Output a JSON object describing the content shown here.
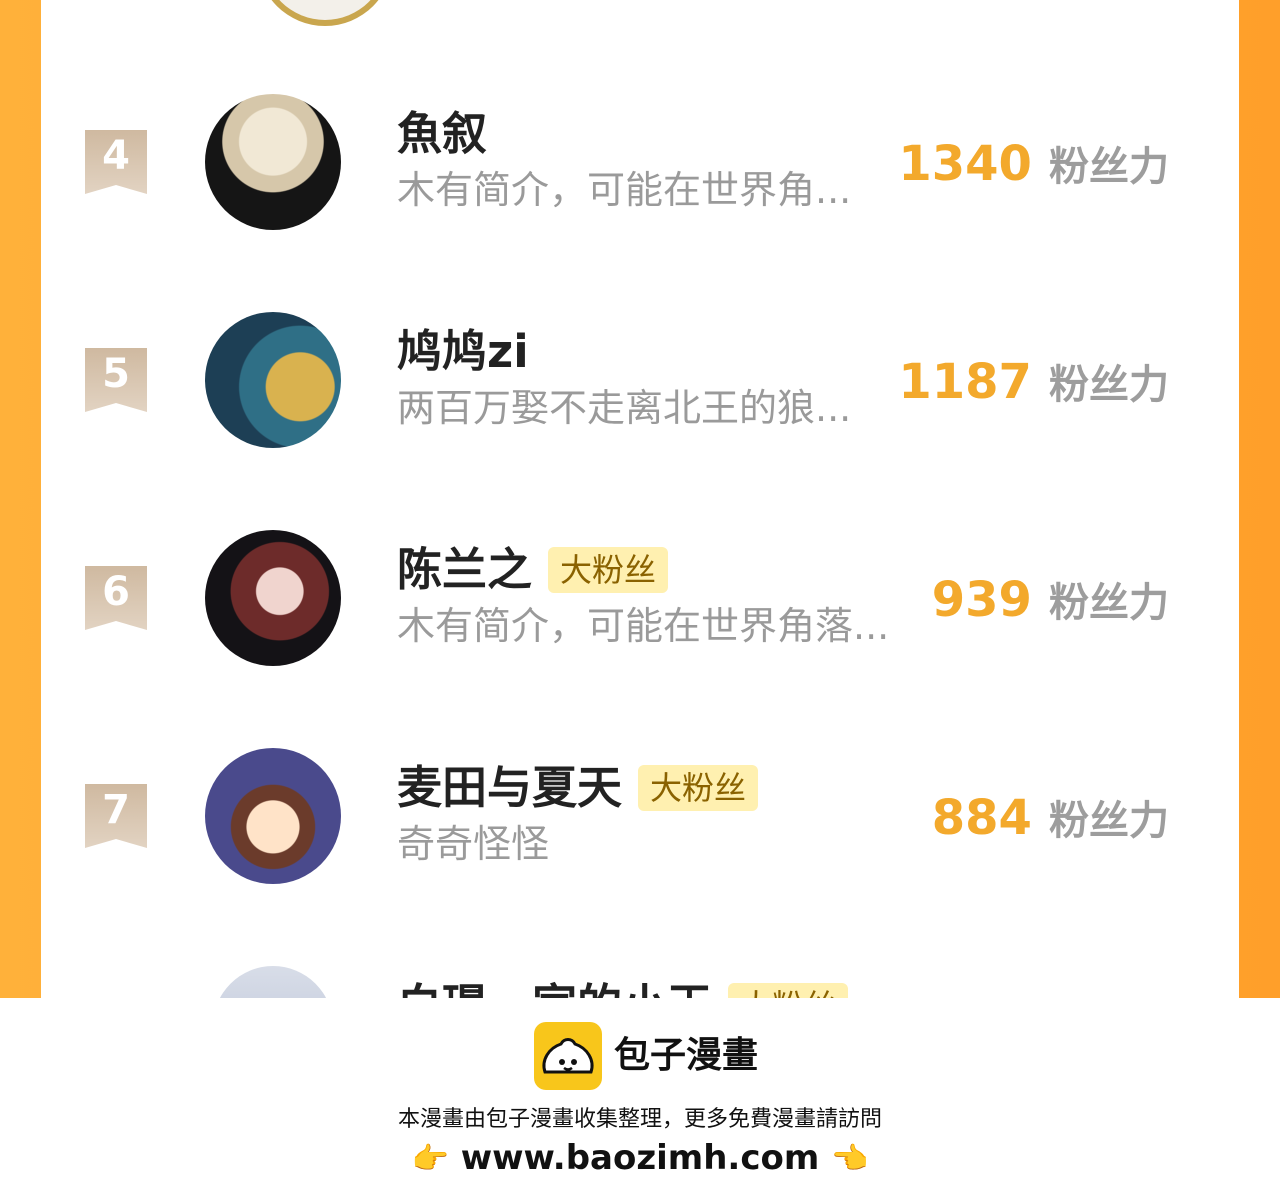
{
  "users": [
    {
      "rank": "4",
      "name": "魚叙",
      "bio": "木有简介，可能在世界角...",
      "score": "1340",
      "score_unit": "粉丝力"
    },
    {
      "rank": "5",
      "name": "鸠鸠zi",
      "bio": "两百万娶不走离北王的狼...",
      "score": "1187",
      "score_unit": "粉丝力"
    },
    {
      "rank": "6",
      "name": "陈兰之",
      "badge": "大粉丝",
      "bio": "木有简介，可能在世界角落...",
      "score": "939",
      "score_unit": "粉丝力"
    },
    {
      "rank": "7",
      "name": "麦田与夏天",
      "badge": "大粉丝",
      "bio": "奇奇怪怪",
      "score": "884",
      "score_unit": "粉丝力"
    }
  ],
  "next_user": {
    "name_partial": "白璟一家的小王",
    "badge": "大粉丝"
  },
  "footer": {
    "brand": "包子漫畫",
    "note": "本漫畫由包子漫畫收集整理，更多免費漫畫請訪問",
    "url": "www.baozimh.com",
    "hand_left": "👉",
    "hand_right": "👈"
  }
}
